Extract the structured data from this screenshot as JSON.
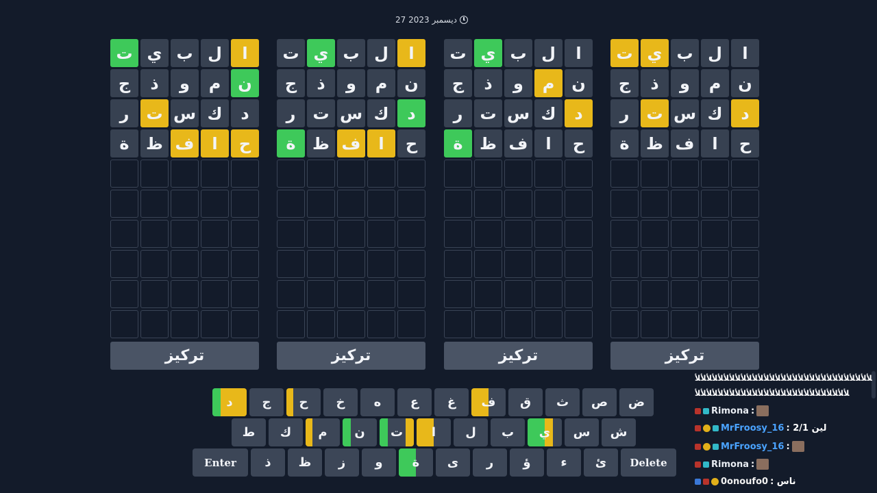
{
  "date": {
    "text": "27 ديسمبر 2023",
    "icon": "clock-icon"
  },
  "colors": {
    "correct": "#3ec95a",
    "present": "#e8b81a",
    "absent": "#374151",
    "key": "#3c4657",
    "focus_button": "#4a5465"
  },
  "guesses": [
    "البيت",
    "نموذج",
    "دكستر",
    "حافظة"
  ],
  "boards": [
    {
      "focus_label": "تركيز",
      "marks": [
        [
          "y",
          "-",
          "-",
          "-",
          "g"
        ],
        [
          "g",
          "-",
          "-",
          "-",
          "-"
        ],
        [
          "-",
          "-",
          "-",
          "y",
          "-"
        ],
        [
          "y",
          "y",
          "y",
          "-",
          "-"
        ]
      ]
    },
    {
      "focus_label": "تركيز",
      "marks": [
        [
          "y",
          "-",
          "-",
          "g",
          "-"
        ],
        [
          "-",
          "-",
          "-",
          "-",
          "-"
        ],
        [
          "g",
          "-",
          "-",
          "-",
          "-"
        ],
        [
          "-",
          "y",
          "y",
          "-",
          "g"
        ]
      ]
    },
    {
      "focus_label": "تركيز",
      "marks": [
        [
          "-",
          "-",
          "-",
          "g",
          "-"
        ],
        [
          "-",
          "y",
          "-",
          "-",
          "-"
        ],
        [
          "y",
          "-",
          "-",
          "-",
          "-"
        ],
        [
          "-",
          "-",
          "-",
          "-",
          "g"
        ]
      ]
    },
    {
      "focus_label": "تركيز",
      "marks": [
        [
          "-",
          "-",
          "-",
          "y",
          "y"
        ],
        [
          "-",
          "-",
          "-",
          "-",
          "-"
        ],
        [
          "y",
          "-",
          "-",
          "y",
          "-"
        ],
        [
          "-",
          "-",
          "-",
          "-",
          "-"
        ]
      ]
    }
  ],
  "keyboard": {
    "row1": [
      {
        "l": "د",
        "s": [
          [
            "g",
            0,
            12
          ],
          [
            "y",
            12,
            50
          ]
        ]
      },
      {
        "l": "ج"
      },
      {
        "l": "ح",
        "s": [
          [
            "y",
            0,
            10
          ]
        ]
      },
      {
        "l": "خ"
      },
      {
        "l": "ه"
      },
      {
        "l": "ع"
      },
      {
        "l": "غ"
      },
      {
        "l": "ف",
        "s": [
          [
            "y",
            0,
            25
          ]
        ]
      },
      {
        "l": "ق"
      },
      {
        "l": "ث"
      },
      {
        "l": "ص"
      },
      {
        "l": "ض"
      }
    ],
    "row2": [
      {
        "l": "ط"
      },
      {
        "l": "ك"
      },
      {
        "l": "م",
        "s": [
          [
            "y",
            0,
            10
          ]
        ]
      },
      {
        "l": "ن",
        "s": [
          [
            "g",
            0,
            12
          ]
        ]
      },
      {
        "l": "ت",
        "s": [
          [
            "g",
            0,
            12
          ],
          [
            "y",
            38,
            50
          ]
        ]
      },
      {
        "l": "ا",
        "s": [
          [
            "y",
            0,
            25
          ]
        ]
      },
      {
        "l": "ل"
      },
      {
        "l": "ب"
      },
      {
        "l": "ي",
        "s": [
          [
            "g",
            0,
            25
          ],
          [
            "y",
            25,
            37
          ]
        ]
      },
      {
        "l": "س"
      },
      {
        "l": "ش"
      }
    ],
    "row3": [
      {
        "l": "Enter",
        "wide": true
      },
      {
        "l": "ذ"
      },
      {
        "l": "ظ"
      },
      {
        "l": "ز"
      },
      {
        "l": "و"
      },
      {
        "l": "ة",
        "s": [
          [
            "g",
            0,
            25
          ]
        ]
      },
      {
        "l": "ى"
      },
      {
        "l": "ر"
      },
      {
        "l": "ؤ"
      },
      {
        "l": "ء"
      },
      {
        "l": "ئ"
      },
      {
        "l": "Delete",
        "wide": true
      }
    ]
  },
  "chat": [
    {
      "user": "",
      "text": "ﻸﻸﻸﻸﻸﻸﻸﻸﻸﻸﻸﻸﻸﻸﻸﻸﻸﻸﻸﻸﻸﻸﻸﻸﻸﻸﻸﻸﻸﻸﻸ",
      "badges": [],
      "user_color": "white"
    },
    {
      "user": "",
      "text": "ﻸﻸﻸﻸﻸﻸﻸﻸﻸﻸﻸﻸﻸﻸﻸﻸﻸﻸﻸﻸﻸﻸﻸﻸﻸﻸﻸ",
      "badges": [],
      "user_color": "white"
    },
    {
      "user": "Rimona",
      "text": ":",
      "badges": [
        "red",
        "teal"
      ],
      "user_color": "white",
      "avatar": true
    },
    {
      "user": "MrFroosy_16",
      "text": ": 2/1 لين",
      "badges": [
        "red",
        "gold",
        "teal"
      ],
      "user_color": "blue"
    },
    {
      "user": "MrFroosy_16",
      "text": ":",
      "badges": [
        "red",
        "gold",
        "teal"
      ],
      "user_color": "blue",
      "avatar": true
    },
    {
      "user": "Rimona",
      "text": ":",
      "badges": [
        "red",
        "teal"
      ],
      "user_color": "white",
      "avatar": true
    },
    {
      "user": "0onoufo0",
      "text": ": ناس",
      "badges": [
        "blue",
        "red",
        "gold"
      ],
      "user_color": "gold"
    }
  ]
}
